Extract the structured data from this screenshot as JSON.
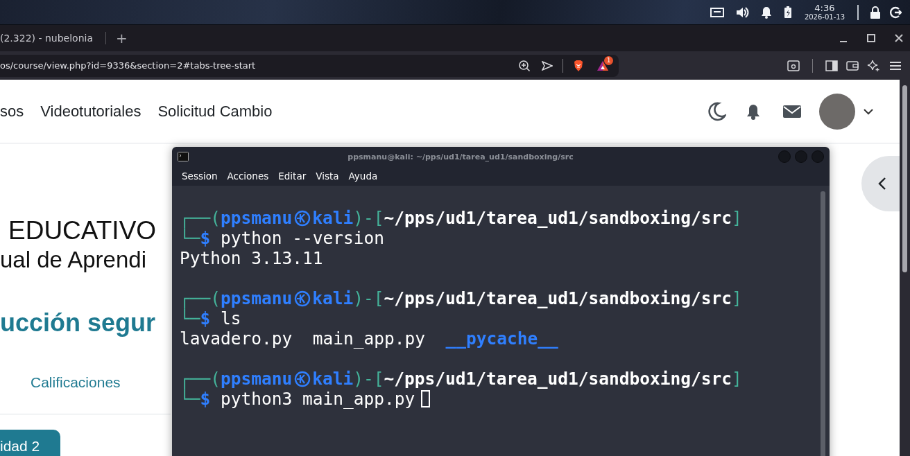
{
  "top_panel": {
    "time": "4:36",
    "date": "2026-01-13"
  },
  "browser": {
    "tab": {
      "title": "(2.322) - nubelonia",
      "selected": true
    },
    "new_tab": "+",
    "url": "os/course/view.php?id=9336&section=2#tabs-tree-start",
    "rewards_badge": "1"
  },
  "site_nav": {
    "items": [
      "sos",
      "Videotutoriales",
      "Solicitud Cambio"
    ]
  },
  "course": {
    "brand_line_1": "EDUCATIVO",
    "brand_line_2": "ual de Aprendi",
    "title": "ucción segur",
    "tabs": [
      {
        "label": "Calificaciones",
        "selected": false
      }
    ],
    "section_button": "idad 2"
  },
  "terminal": {
    "title": "ppsmanu@kali: ~/pps/ud1/tarea_ud1/sandboxing/src",
    "menu": [
      "Session",
      "Acciones",
      "Editar",
      "Vista",
      "Ayuda"
    ],
    "blocks": [
      {
        "prompt": {
          "open": "┌──(",
          "user": "ppsmanu",
          "host": "kali",
          "mid": ")-[",
          "path": "~/pps/ud1/tarea_ud1/sandboxing/src",
          "close": "]",
          "corner": "└─",
          "sigil": "$"
        },
        "command": "python --version",
        "output": [
          {
            "text": "Python 3.13.11",
            "kind": "file"
          }
        ],
        "cursor": false
      },
      {
        "prompt": {
          "open": "┌──(",
          "user": "ppsmanu",
          "host": "kali",
          "mid": ")-[",
          "path": "~/pps/ud1/tarea_ud1/sandboxing/src",
          "close": "]",
          "corner": "└─",
          "sigil": "$"
        },
        "command": "ls",
        "output": [
          {
            "text": "lavadero.py",
            "kind": "file"
          },
          {
            "text": "main_app.py",
            "kind": "file"
          },
          {
            "text": "__pycache__",
            "kind": "dir"
          }
        ],
        "cursor": false
      },
      {
        "prompt": {
          "open": "┌──(",
          "user": "ppsmanu",
          "host": "kali",
          "mid": ")-[",
          "path": "~/pps/ud1/tarea_ud1/sandboxing/src",
          "close": "]",
          "corner": "└─",
          "sigil": "$"
        },
        "command": "python3 main_app.py",
        "cursor": true
      }
    ]
  }
}
